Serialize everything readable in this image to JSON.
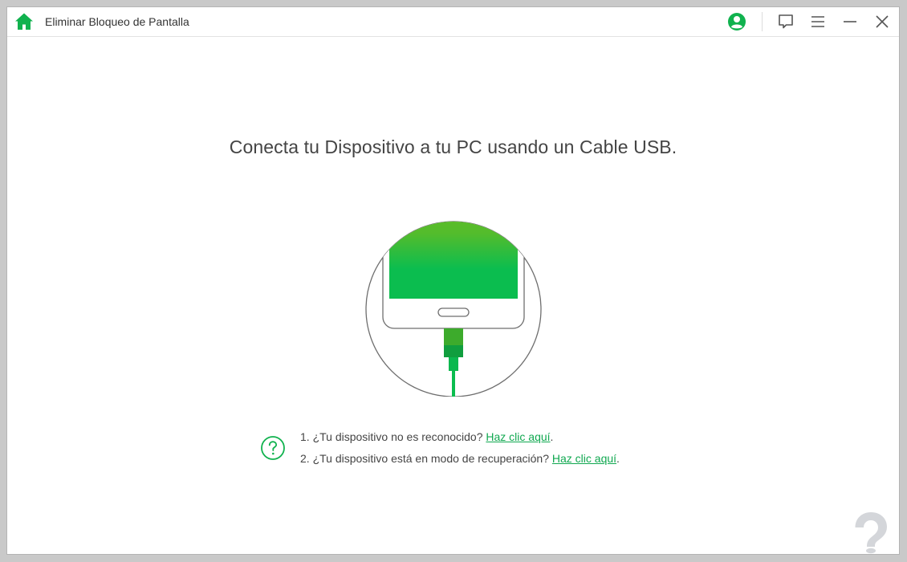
{
  "window": {
    "title": "Eliminar Bloqueo de Pantalla"
  },
  "titlebar": {
    "icons": [
      "home-icon",
      "account-icon",
      "feedback-icon",
      "menu-icon",
      "minimize-icon",
      "close-icon"
    ]
  },
  "colors": {
    "accent": "#10b24e",
    "link": "#10a850",
    "phone_top": "#6cbe1e",
    "phone_bottom": "#0bbd4f"
  },
  "main": {
    "heading": "Conecta tu Dispositivo a tu PC usando un Cable USB."
  },
  "help": {
    "items": [
      {
        "prefix": "1. ¿Tu dispositivo no es reconocido? ",
        "link": "Haz clic aquí",
        "suffix": "."
      },
      {
        "prefix": "2. ¿Tu dispositivo está en modo de recuperación? ",
        "link": "Haz clic aquí",
        "suffix": "."
      }
    ]
  }
}
